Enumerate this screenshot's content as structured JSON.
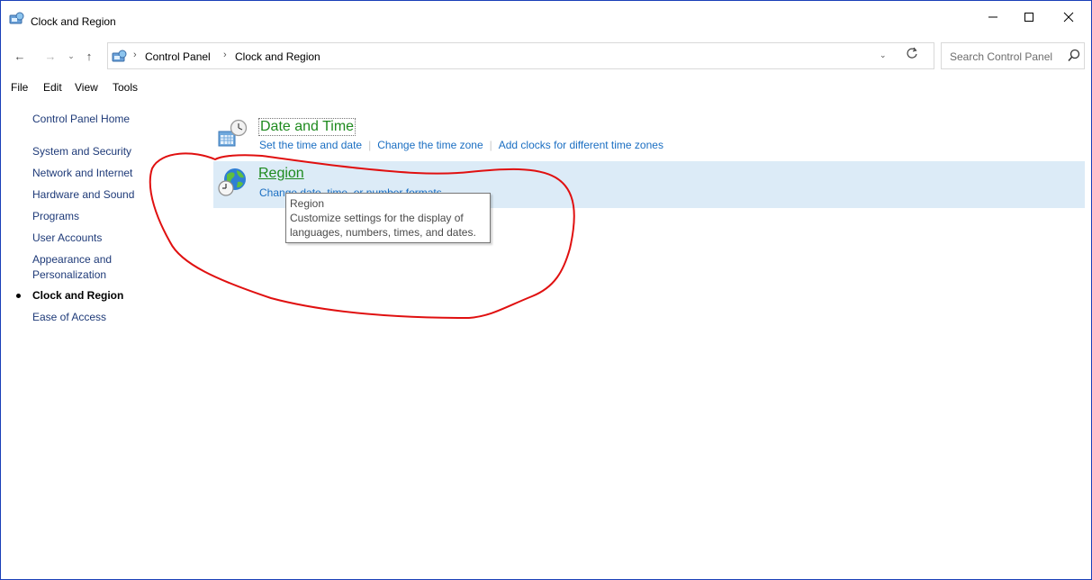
{
  "window": {
    "title": "Clock and Region"
  },
  "address": {
    "breadcrumbs": [
      "Control Panel",
      "Clock and Region"
    ],
    "search_placeholder": "Search Control Panel"
  },
  "menu": [
    "File",
    "Edit",
    "View",
    "Tools"
  ],
  "sidebar": {
    "items": [
      {
        "label": "Control Panel Home"
      },
      {
        "label": "System and Security"
      },
      {
        "label": "Network and Internet"
      },
      {
        "label": "Hardware and Sound"
      },
      {
        "label": "Programs"
      },
      {
        "label": "User Accounts"
      },
      {
        "label": "Appearance and"
      },
      {
        "label": "Personalization"
      },
      {
        "label": "Clock and Region"
      },
      {
        "label": "Ease of Access"
      }
    ]
  },
  "categories": {
    "datetime": {
      "title": "Date and Time",
      "icon": "clock-calendar-icon",
      "links": [
        "Set the time and date",
        "Change the time zone",
        "Add clocks for different time zones"
      ]
    },
    "region": {
      "title": "Region",
      "icon": "globe-clock-icon",
      "links": [
        "Change date, time, or number formats"
      ]
    }
  },
  "tooltip": {
    "title": "Region",
    "lines": [
      "Customize settings for the display of",
      "languages, numbers, times, and dates."
    ]
  },
  "colors": {
    "accent_link": "#1a6ec2",
    "category_title": "#1e8a1e",
    "selected_row": "#dcebf7",
    "annotation": "#e01010",
    "window_border": "#1a3fb8"
  }
}
